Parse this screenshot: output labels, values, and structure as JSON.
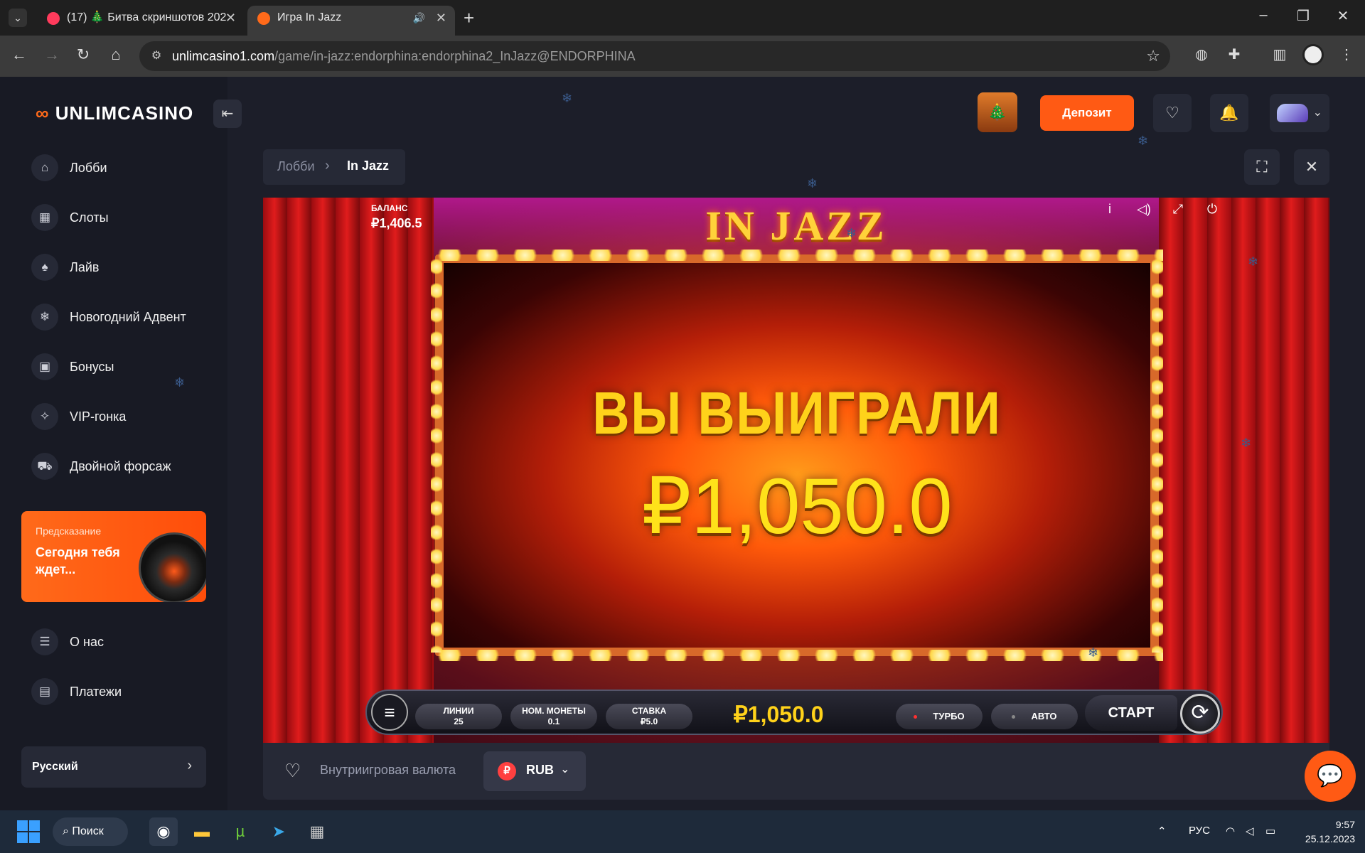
{
  "browser": {
    "tabs": [
      {
        "title": "(17) 🎄 Битва скриншотов 202"
      },
      {
        "title": "Игра In Jazz"
      }
    ],
    "url_host": "unlimcasino1.com",
    "url_path": "/game/in-jazz:endorphina:endorphina2_InJazz@ENDORPHINA"
  },
  "site": {
    "logo_mark": "∞",
    "logo_text": "UNLIMCASINO",
    "nav": [
      {
        "label": "Лобби",
        "icon": "home-icon"
      },
      {
        "label": "Слоты",
        "icon": "slots-icon"
      },
      {
        "label": "Лайв",
        "icon": "live-icon"
      },
      {
        "label": "Новогодний Адвент",
        "icon": "snowflake-icon"
      },
      {
        "label": "Бонусы",
        "icon": "bonus-icon"
      },
      {
        "label": "VIP-гонка",
        "icon": "vip-icon"
      },
      {
        "label": "Двойной форсаж",
        "icon": "car-icon"
      }
    ],
    "promo": {
      "small": "Предсказание",
      "big": "Сегодня тебя ждет..."
    },
    "nav_bottom": [
      {
        "label": "О нас",
        "icon": "document-icon"
      },
      {
        "label": "Платежи",
        "icon": "wallet-icon"
      }
    ],
    "language": "Русский",
    "deposit_label": "Депозит",
    "breadcrumb": {
      "lobby": "Лобби",
      "current": "In Jazz"
    },
    "footer": {
      "currency_label": "Внутриигровая валюта",
      "currency_code": "RUB",
      "currency_symbol": "₽"
    }
  },
  "game": {
    "title": "IN JAZZ",
    "balance_label": "БАЛАНС",
    "balance_value": "₽1,406.5",
    "win_label": "ВЫ ВЫИГРАЛИ",
    "win_value": "₽1,050.0",
    "lines_label": "ЛИНИИ",
    "lines_value": "25",
    "coin_label": "НОМ. МОНЕТЫ",
    "coin_value": "0.1",
    "bet_label": "СТАВКА",
    "bet_value": "₽5.0",
    "total_win": "₽1,050.0",
    "turbo_label": "ТУРБО",
    "auto_label": "АВТО",
    "start_label": "СТАРТ"
  },
  "taskbar": {
    "search_label": "Поиск",
    "lang": "РУС",
    "time": "9:57",
    "date": "25.12.2023"
  },
  "colors": {
    "accent": "#ff5a14",
    "win_gold": "#ffd21a"
  }
}
